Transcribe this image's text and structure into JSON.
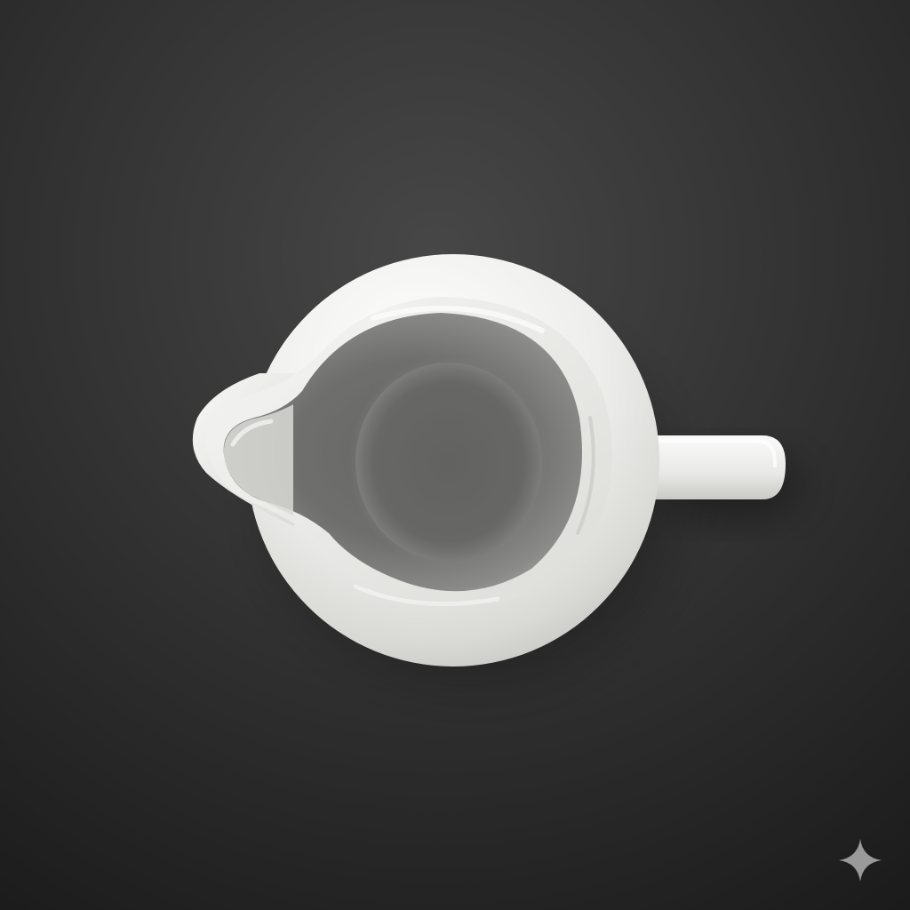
{
  "scene": {
    "subject_icon": "pitcher-icon",
    "background_color": "#2a2a2a",
    "porcelain_color": "#ececea",
    "interior_color": "#6a6a68"
  },
  "watermark": {
    "icon": "sparkle-icon",
    "color": "#9a9a9a"
  }
}
